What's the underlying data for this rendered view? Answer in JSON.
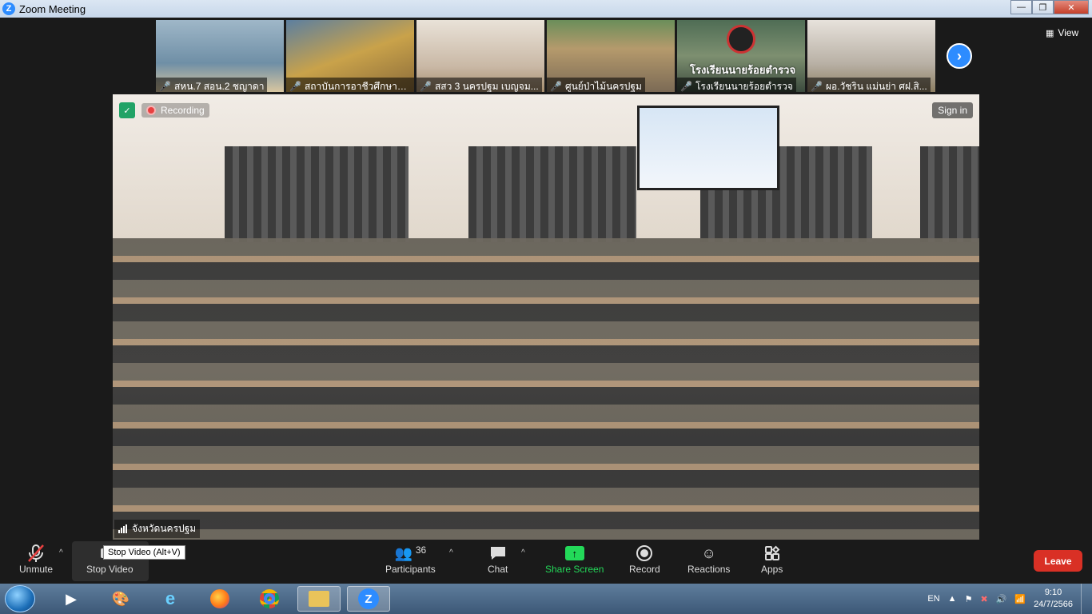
{
  "window": {
    "title": "Zoom Meeting",
    "logo": "Z",
    "minimize": "—",
    "maximize": "❐",
    "close": "✕"
  },
  "thumbnails": [
    {
      "label": "สหน.7 สอน.2 ชญาดา",
      "bg": "#6f8fa6"
    },
    {
      "label": "สถาบันการอาชีวศึกษาภ...",
      "bg": "#8a7b54"
    },
    {
      "label": "สสว 3 นครปฐม เบญจม...",
      "bg": "#c9b8a5"
    },
    {
      "label": "ศูนย์ป่าไม้นครปฐม",
      "bg": "#7b6a55"
    },
    {
      "label": "โรงเรียนนายร้อยตำรวจ",
      "bg": "#5d7762",
      "overlay": "โรงเรียนนายร้อยตำรวจ"
    },
    {
      "label": "ผอ.วัชริน แม่นย่า ศฝ.สิ...",
      "bg": "#b9b1a6"
    }
  ],
  "view_label": "View",
  "next_icon": "›",
  "main": {
    "recording_label": "Recording",
    "sign_in_label": "Sign in",
    "speaker_label": "จังหวัดนครปฐม"
  },
  "toolbar": {
    "unmute": "Unmute",
    "stop_video": "Stop Video",
    "tooltip": "Stop Video (Alt+V)",
    "participants": "Participants",
    "participants_count": "36",
    "chat": "Chat",
    "share_screen": "Share Screen",
    "record": "Record",
    "reactions": "Reactions",
    "apps": "Apps",
    "leave": "Leave",
    "caret": "^"
  },
  "taskbar": {
    "language": "EN",
    "time": "9:10",
    "date": "24/7/2566"
  },
  "colors": {
    "accent": "#2d8cff",
    "leave": "#d93025",
    "share": "#23d959",
    "recording": "#e84040"
  }
}
